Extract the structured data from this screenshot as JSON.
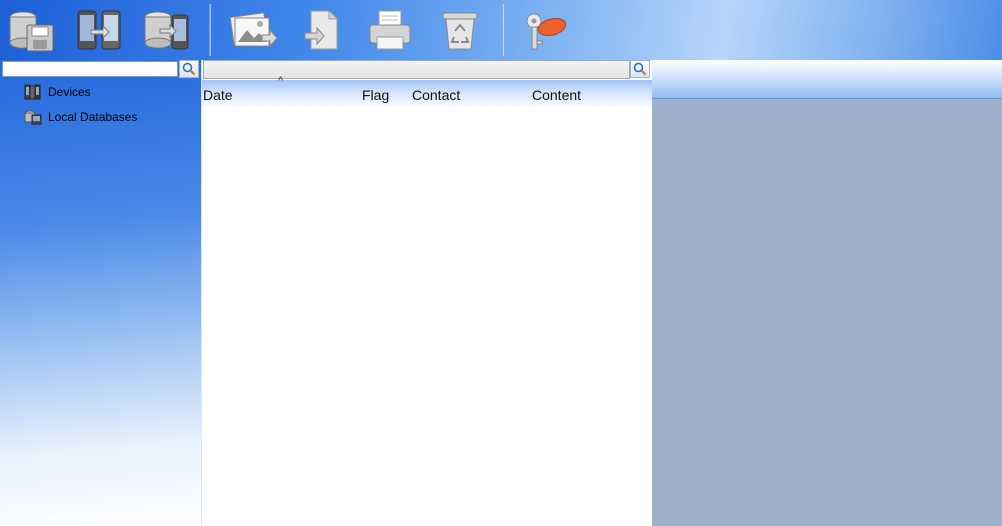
{
  "toolbar": {
    "buttons": [
      {
        "icon": "database-save-icon",
        "title": "Save database"
      },
      {
        "icon": "phone-transfer-icon",
        "title": "Phone transfer"
      },
      {
        "icon": "database-phone-icon",
        "title": "Database to phone"
      },
      {
        "icon": "image-export-icon",
        "title": "Image export"
      },
      {
        "icon": "document-export-icon",
        "title": "Export"
      },
      {
        "icon": "printer-icon",
        "title": "Print"
      },
      {
        "icon": "recycle-bin-icon",
        "title": "Delete"
      },
      {
        "icon": "keys-icon",
        "title": "Keys"
      }
    ]
  },
  "left_panel": {
    "search": {
      "value": "",
      "placeholder": ""
    },
    "tree": [
      {
        "label": "Devices",
        "icon": "devices-icon"
      },
      {
        "label": "Local Databases",
        "icon": "local-databases-icon"
      }
    ]
  },
  "message_list": {
    "search": {
      "value": "",
      "placeholder": ""
    },
    "columns": {
      "date": "Date",
      "flag": "Flag",
      "contact": "Contact",
      "content": "Content"
    },
    "sort_indicator": "^"
  },
  "colors": {
    "toolbar_blue": "#3f86ea",
    "right_panel": "#9eb0cb"
  }
}
